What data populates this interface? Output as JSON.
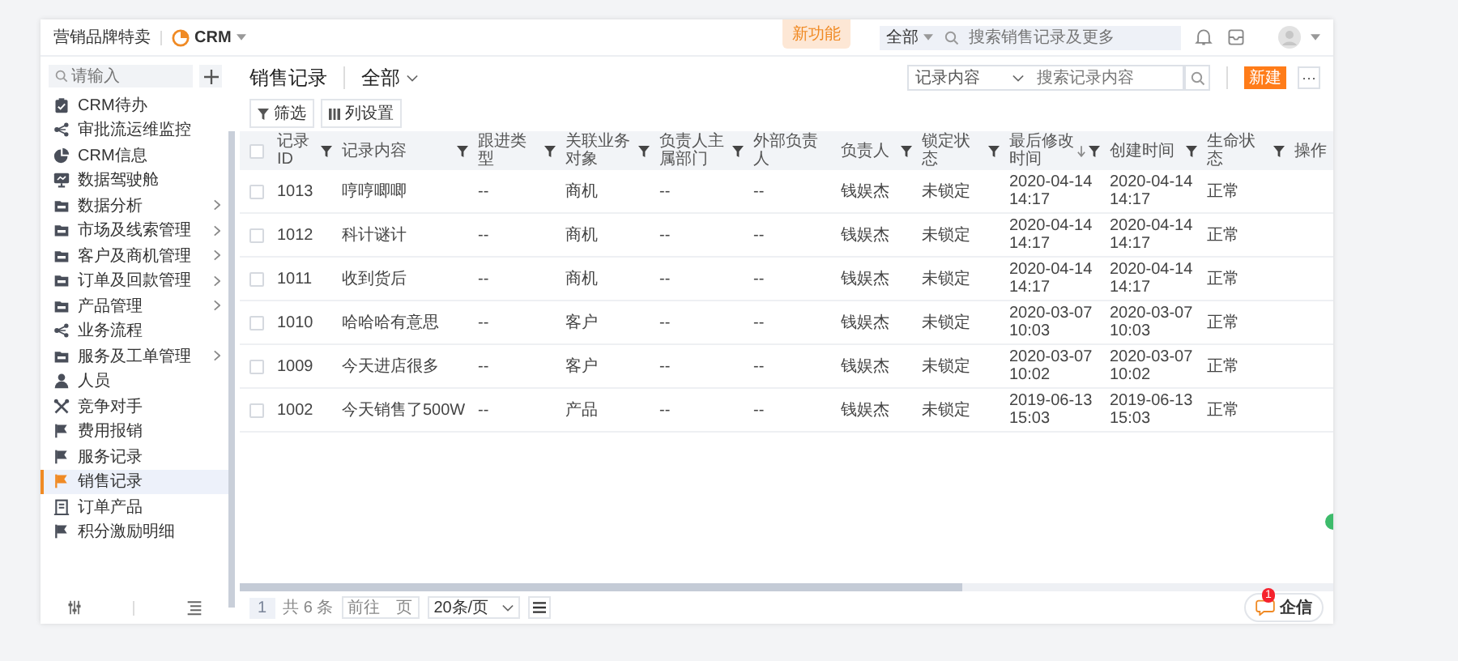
{
  "header": {
    "company": "营销品牌特卖",
    "app_name": "CRM",
    "new_feature_badge": "新功能",
    "search_scope": "全部",
    "search_placeholder": "搜索销售记录及更多"
  },
  "sidebar": {
    "search_placeholder": "请输入",
    "items": [
      {
        "label": "CRM待办",
        "kind": "clipboard",
        "expandable": false,
        "selected": false
      },
      {
        "label": "审批流运维监控",
        "kind": "flow",
        "expandable": false,
        "selected": false
      },
      {
        "label": "CRM信息",
        "kind": "pie",
        "expandable": false,
        "selected": false
      },
      {
        "label": "数据驾驶舱",
        "kind": "monitor",
        "expandable": false,
        "selected": false
      },
      {
        "label": "数据分析",
        "kind": "folder",
        "expandable": true,
        "selected": false
      },
      {
        "label": "市场及线索管理",
        "kind": "folder",
        "expandable": true,
        "selected": false
      },
      {
        "label": "客户及商机管理",
        "kind": "folder",
        "expandable": true,
        "selected": false
      },
      {
        "label": "订单及回款管理",
        "kind": "folder",
        "expandable": true,
        "selected": false
      },
      {
        "label": "产品管理",
        "kind": "folder",
        "expandable": true,
        "selected": false
      },
      {
        "label": "业务流程",
        "kind": "flow",
        "expandable": false,
        "selected": false
      },
      {
        "label": "服务及工单管理",
        "kind": "folder",
        "expandable": true,
        "selected": false
      },
      {
        "label": "人员",
        "kind": "person",
        "expandable": false,
        "selected": false
      },
      {
        "label": "竞争对手",
        "kind": "tools",
        "expandable": false,
        "selected": false
      },
      {
        "label": "费用报销",
        "kind": "flag",
        "expandable": false,
        "selected": false
      },
      {
        "label": "服务记录",
        "kind": "flag",
        "expandable": false,
        "selected": false
      },
      {
        "label": "销售记录",
        "kind": "flag",
        "expandable": false,
        "selected": true
      },
      {
        "label": "订单产品",
        "kind": "building",
        "expandable": false,
        "selected": false
      },
      {
        "label": "积分激励明细",
        "kind": "flag",
        "expandable": false,
        "selected": false
      }
    ]
  },
  "page": {
    "title": "销售记录",
    "view": "全部",
    "filter_button": "筛选",
    "columns_button": "列设置",
    "search_field": "记录内容",
    "search_placeholder": "搜索记录内容",
    "new_button": "新建",
    "more_button": "···"
  },
  "table": {
    "all_checked": false,
    "columns": [
      {
        "label": "记录ID",
        "filterable": true,
        "sorted_descending": false
      },
      {
        "label": "记录内容",
        "filterable": true,
        "sorted_descending": false
      },
      {
        "label": "跟进类型",
        "filterable": true,
        "sorted_descending": false
      },
      {
        "label": "关联业务对象",
        "filterable": true,
        "sorted_descending": false
      },
      {
        "label": "负责人主属部门",
        "filterable": true,
        "sorted_descending": false
      },
      {
        "label": "外部负责人",
        "filterable": false,
        "sorted_descending": false
      },
      {
        "label": "负责人",
        "filterable": true,
        "sorted_descending": false
      },
      {
        "label": "锁定状态",
        "filterable": true,
        "sorted_descending": false
      },
      {
        "label": "最后修改时间",
        "filterable": true,
        "sorted_descending": true
      },
      {
        "label": "创建时间",
        "filterable": true,
        "sorted_descending": false
      },
      {
        "label": "生命状态",
        "filterable": true,
        "sorted_descending": false
      },
      {
        "label": "操作",
        "filterable": false,
        "sorted_descending": false
      }
    ],
    "rows": [
      {
        "checked": false,
        "cells": [
          "1013",
          "哼哼唧唧",
          "--",
          "商机",
          "--",
          "--",
          "钱娱杰",
          "未锁定",
          "2020-04-14 14:17",
          "2020-04-14 14:17",
          "正常"
        ]
      },
      {
        "checked": false,
        "cells": [
          "1012",
          "科计谜计",
          "--",
          "商机",
          "--",
          "--",
          "钱娱杰",
          "未锁定",
          "2020-04-14 14:17",
          "2020-04-14 14:17",
          "正常"
        ]
      },
      {
        "checked": false,
        "cells": [
          "1011",
          "收到货后",
          "--",
          "商机",
          "--",
          "--",
          "钱娱杰",
          "未锁定",
          "2020-04-14 14:17",
          "2020-04-14 14:17",
          "正常"
        ]
      },
      {
        "checked": false,
        "cells": [
          "1010",
          "哈哈哈有意思",
          "--",
          "客户",
          "--",
          "--",
          "钱娱杰",
          "未锁定",
          "2020-03-07 10:03",
          "2020-03-07 10:03",
          "正常"
        ]
      },
      {
        "checked": false,
        "cells": [
          "1009",
          "今天进店很多",
          "--",
          "客户",
          "--",
          "--",
          "钱娱杰",
          "未锁定",
          "2020-03-07 10:02",
          "2020-03-07 10:02",
          "正常"
        ]
      },
      {
        "checked": false,
        "cells": [
          "1002",
          "今天销售了500W",
          "--",
          "产品",
          "--",
          "--",
          "钱娱杰",
          "未锁定",
          "2019-06-13 15:03",
          "2019-06-13 15:03",
          "正常"
        ]
      }
    ]
  },
  "pagination": {
    "current_page": "1",
    "total": "共 6 条",
    "goto_label": "前往",
    "page_unit": "页",
    "page_size": "20条/页"
  },
  "chat": {
    "label": "企信",
    "badge": "1"
  }
}
